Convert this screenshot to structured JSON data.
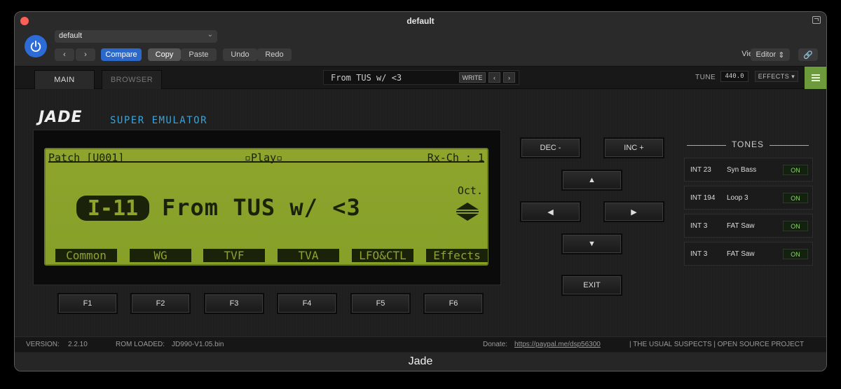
{
  "window": {
    "title": "default",
    "footer": "Jade"
  },
  "host": {
    "preset": "default",
    "compare": "Compare",
    "copy": "Copy",
    "paste": "Paste",
    "undo": "Undo",
    "redo": "Redo",
    "view_label": "View:",
    "view_value": "Editor"
  },
  "plugin": {
    "tabs": [
      "MAIN",
      "BROWSER"
    ],
    "patch_name": "From TUS w/ <3",
    "write": "WRITE",
    "tune_label": "TUNE",
    "tune_value": "440.0",
    "effects": "EFFECTS"
  },
  "logo": {
    "brand": "JADE",
    "subtitle": "SUPER EMULATOR"
  },
  "lcd": {
    "patch": "Patch [U001]",
    "mode": "Play",
    "rx": "Rx-Ch : 1",
    "tag": "I-11",
    "name": "From TUS w/ <3",
    "oct": "Oct.",
    "functions": [
      "Common",
      "WG",
      "TVF",
      "TVA",
      "LFO&CTL",
      "Effects"
    ]
  },
  "fkeys": [
    "F1",
    "F2",
    "F3",
    "F4",
    "F5",
    "F6"
  ],
  "nav": {
    "dec": "DEC -",
    "inc": "INC +",
    "exit": "EXIT"
  },
  "tones": {
    "title": "TONES",
    "items": [
      {
        "num": "INT 23",
        "name": "Syn Bass",
        "state": "ON"
      },
      {
        "num": "INT 194",
        "name": "Loop 3",
        "state": "ON"
      },
      {
        "num": "INT 3",
        "name": "FAT Saw",
        "state": "ON"
      },
      {
        "num": "INT 3",
        "name": "FAT Saw",
        "state": "ON"
      }
    ]
  },
  "status": {
    "version_label": "VERSION:",
    "version": "2.2.10",
    "rom_label": "ROM LOADED:",
    "rom": "JD990-V1.05.bin",
    "donate_label": "Donate:",
    "donate_link": "https://paypal.me/dsp56300",
    "credits": "| THE USUAL SUSPECTS | OPEN SOURCE PROJECT"
  }
}
